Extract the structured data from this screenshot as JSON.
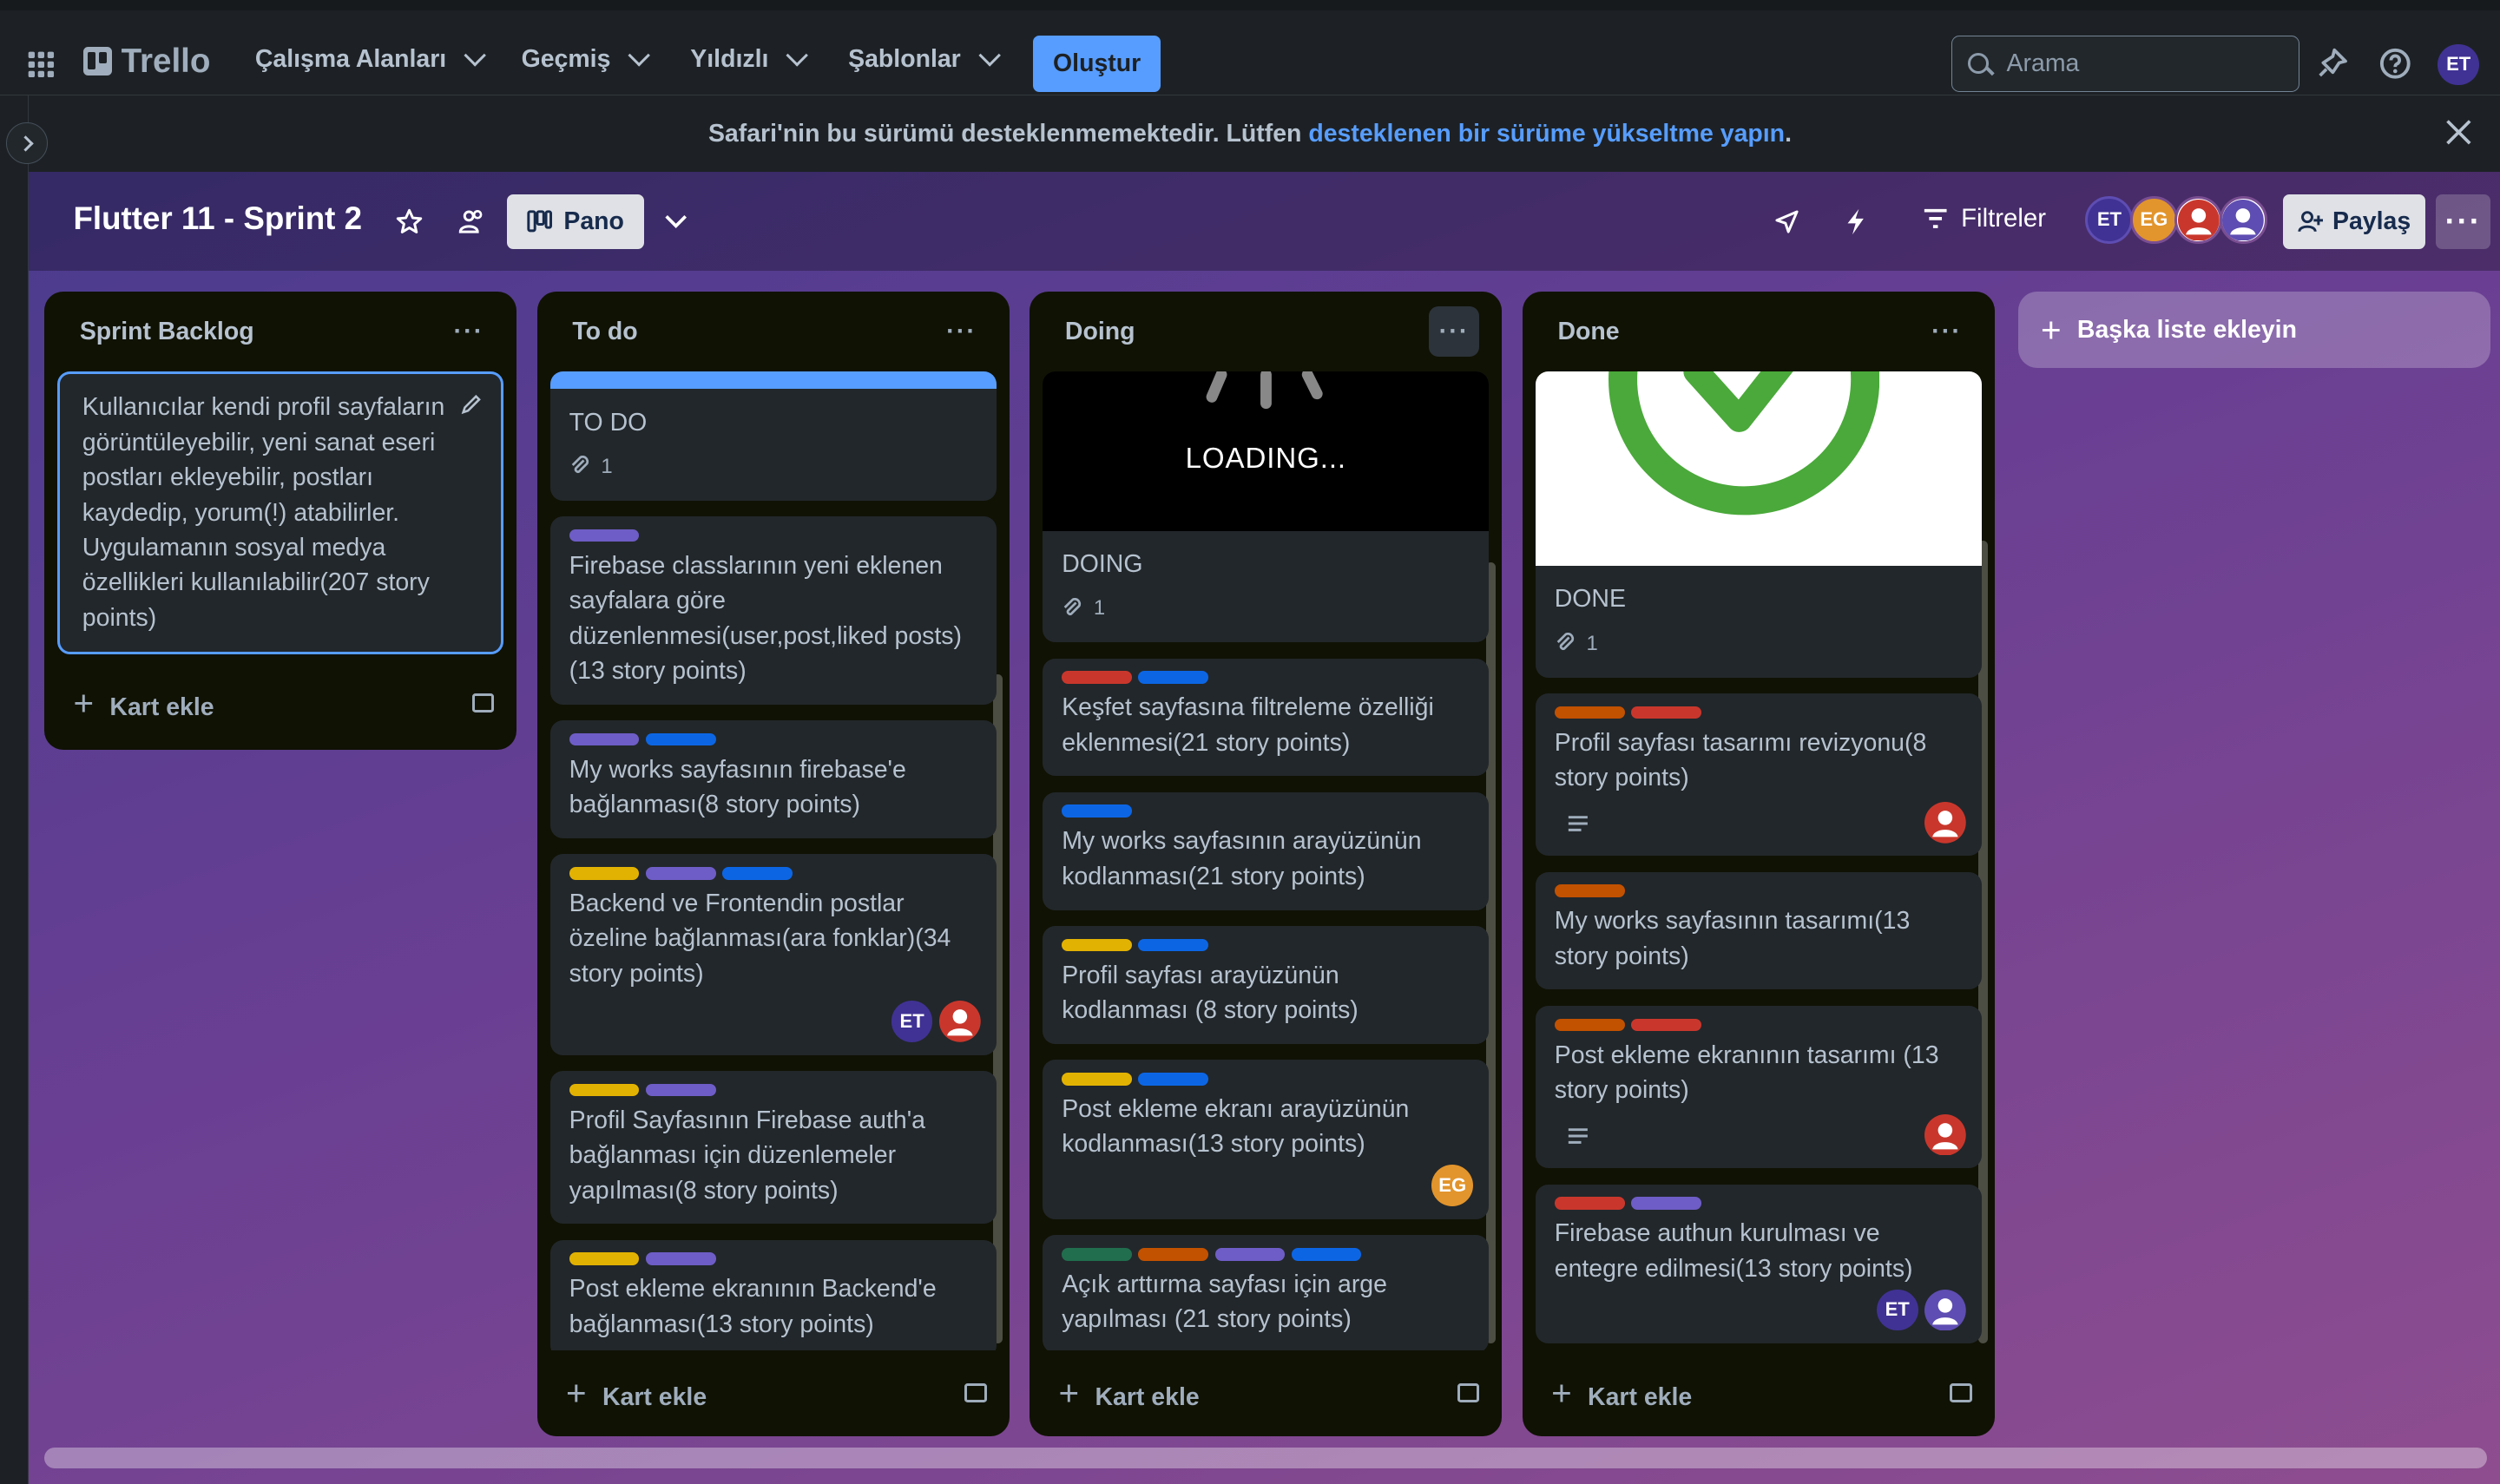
{
  "topbar": {
    "logo": "Trello",
    "nav": [
      "Çalışma Alanları",
      "Geçmiş",
      "Yıldızlı",
      "Şablonlar"
    ],
    "create": "Oluştur",
    "search_placeholder": "Arama",
    "user_initials": "ET"
  },
  "banner": {
    "text_before": "Safari'nin bu sürümü desteklenmemektedir. Lütfen ",
    "link": "desteklenen bir sürüme yükseltme yapın",
    "text_after": "."
  },
  "board": {
    "title": "Flutter 11 - Sprint 2",
    "view": "Pano",
    "filters": "Filtreler",
    "share": "Paylaş",
    "members": [
      "ET",
      "EG"
    ]
  },
  "colors": {
    "purple": "#6e5dc6",
    "blue": "#0c66e4",
    "yellow": "#e2b203",
    "green": "#4bce97",
    "orange": "#c25100",
    "red": "#c9372c",
    "darkgreen": "#216e4e"
  },
  "lists": [
    {
      "title": "Sprint Backlog",
      "add": "Kart ekle",
      "cards": [
        {
          "text": "Kullanıcılar kendi profil sayfaların görüntüleyebilir, yeni sanat eseri postları ekleyebilir, postları kaydedip, yorum(!) atabilirler. Uygulamanın sosyal medya özellikleri kullanılabilir(207 story points)"
        }
      ]
    },
    {
      "title": "To do",
      "add": "Kart ekle",
      "cards": [
        {
          "text": "TO DO",
          "attachments": "1"
        },
        {
          "text": "Firebase classlarının yeni eklenen sayfalara göre düzenlenmesi(user,post,liked posts)(13 story points)"
        },
        {
          "text": "My works sayfasının firebase'e bağlanması(8 story points)"
        },
        {
          "text": "Backend ve Frontendin postlar özeline bağlanması(ara fonklar)(34 story points)",
          "member": "ET"
        },
        {
          "text": "Profil Sayfasının Firebase auth'a bağlanması için düzenlemeler yapılması(8 story points)"
        },
        {
          "text": "Post ekleme ekranının Backend'e bağlanması(13 story points)"
        }
      ]
    },
    {
      "title": "Doing",
      "add": "Kart ekle",
      "cards": [
        {
          "text": "DOING",
          "cover_text": "LOADING...",
          "attachments": "1"
        },
        {
          "text": "Keşfet sayfasına filtreleme özelliği eklenmesi(21 story points)"
        },
        {
          "text": "My works sayfasının arayüzünün kodlanması(21 story points)"
        },
        {
          "text": "Profil sayfası arayüzünün kodlanması (8 story points)"
        },
        {
          "text": "Post ekleme ekranı arayüzünün kodlanması(13 story points)",
          "member": "EG"
        },
        {
          "text": "Açık arttırma sayfası için arge yapılması (21 story points)"
        }
      ]
    },
    {
      "title": "Done",
      "add": "Kart ekle",
      "cards": [
        {
          "text": "DONE",
          "attachments": "1"
        },
        {
          "text": "Profil sayfası tasarımı revizyonu(8 story points)"
        },
        {
          "text": "My works sayfasının tasarımı(13 story points)"
        },
        {
          "text": "Post ekleme ekranının tasarımı (13 story points)"
        },
        {
          "text": "Firebase authun kurulması ve entegre edilmesi(13 story points)",
          "member": "ET"
        }
      ]
    }
  ],
  "add_list": "Başka liste ekleyin"
}
